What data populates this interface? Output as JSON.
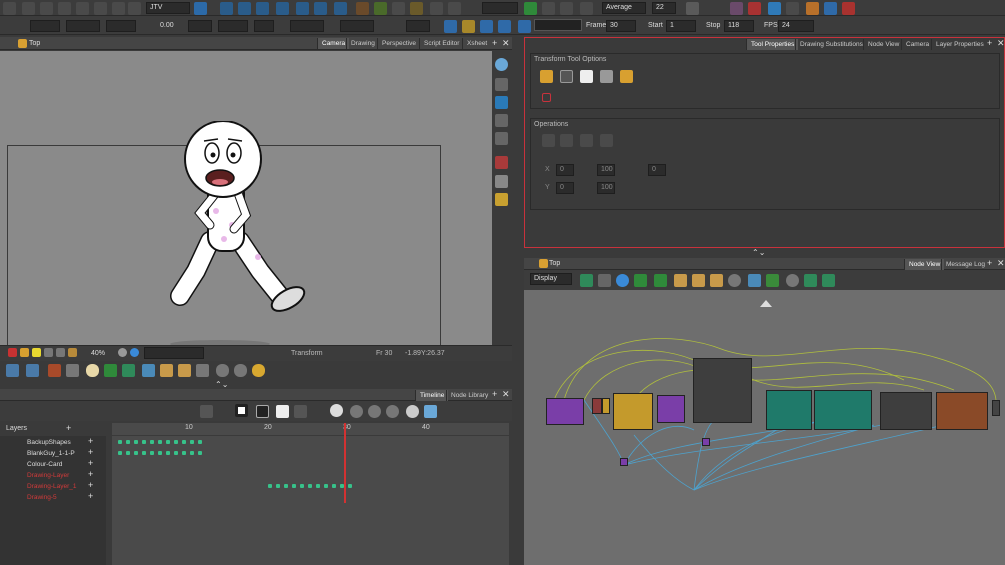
{
  "toolbar": {
    "dropdown_jtv": "JTV",
    "val_rotate": "0.00",
    "dropdown_average": "Average",
    "val_22": "22",
    "frame_label": "Frame",
    "frame_value": "30",
    "start_label": "Start",
    "start_value": "1",
    "stop_label": "Stop",
    "stop_value": "118",
    "fps_label": "FPS",
    "fps_value": "24"
  },
  "camera_panel": {
    "title": "Top",
    "tabs": [
      "Camera",
      "Drawing",
      "Perspective",
      "Script Editor",
      "Xsheet"
    ],
    "status_zoom": "40%",
    "status_tool": "Transform",
    "status_frame": "Fr 30",
    "status_coords": "-1.89Y:26.37"
  },
  "tool_properties": {
    "tabs": [
      "Tool Properties",
      "Drawing Substitutions",
      "Node View",
      "Camera",
      "Layer Properties"
    ],
    "section_options": "Transform Tool Options",
    "section_operations": "Operations",
    "fields": [
      "0",
      "0",
      "0",
      "100",
      "100"
    ]
  },
  "node_view": {
    "title": "Top",
    "tabs": [
      "Node View",
      "Message Log"
    ],
    "display_dropdown": "Display"
  },
  "timeline": {
    "tabs": [
      "Timeline",
      "Node Library"
    ],
    "layers_label": "Layers",
    "ruler": [
      "10",
      "20",
      "30",
      "40"
    ],
    "layers": [
      {
        "name": "BackupShapes",
        "color": "#dddddd"
      },
      {
        "name": "BlankGuy_1-1-P",
        "color": "#dddddd"
      },
      {
        "name": "Colour-Card",
        "color": "#dddddd"
      },
      {
        "name": "Drawing-Layer",
        "color": "#d23a3a"
      },
      {
        "name": "Drawing-Layer_1",
        "color": "#d23a3a"
      },
      {
        "name": "Drawing-5",
        "color": "#d23a3a"
      }
    ]
  },
  "colors": {
    "accent_red": "#c8323c",
    "panel_bg": "#3a3a3a",
    "node_purple": "#7a3ea8",
    "node_yellow": "#c49a2c",
    "node_teal": "#1f7a6a",
    "node_gray": "#3e3e3e",
    "node_orange": "#8a4a28",
    "wire_blue": "#4aa8d8",
    "wire_green": "#b8c838"
  }
}
